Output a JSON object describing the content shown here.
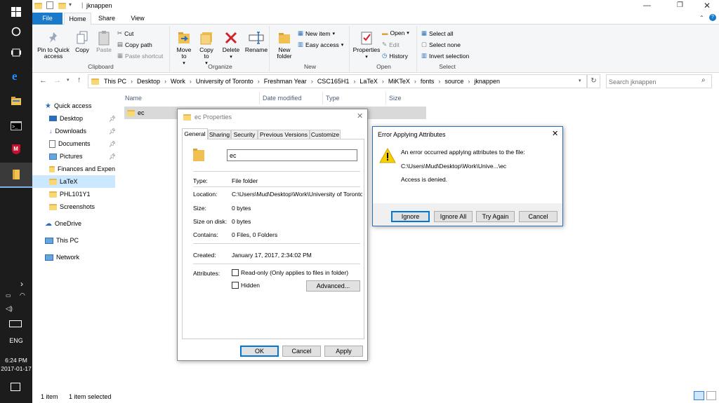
{
  "taskbar": {
    "time": "6:24 PM",
    "date": "2017-01-17",
    "language": "ENG",
    "icons": [
      "windows-start-icon",
      "cortana-icon",
      "task-view-icon",
      "edge-icon",
      "file-explorer-icon",
      "terminal-icon",
      "mcafee-icon",
      "folder-icon"
    ]
  },
  "explorer": {
    "title": "jknappen",
    "tabs": [
      "File",
      "Home",
      "Share",
      "View"
    ],
    "ribbon": {
      "clipboard": {
        "label": "Clipboard",
        "pin": "Pin to Quick access",
        "copy": "Copy",
        "paste": "Paste",
        "cut": "Cut",
        "copy_path": "Copy path",
        "paste_shortcut": "Paste shortcut"
      },
      "organize": {
        "label": "Organize",
        "move_to": "Move to",
        "copy_to": "Copy to",
        "delete": "Delete",
        "rename": "Rename"
      },
      "new": {
        "label": "New",
        "new_folder": "New folder",
        "new_item": "New item",
        "easy_access": "Easy access"
      },
      "open": {
        "label": "Open",
        "properties": "Properties",
        "open": "Open",
        "edit": "Edit",
        "history": "History"
      },
      "select": {
        "label": "Select",
        "select_all": "Select all",
        "select_none": "Select none",
        "invert": "Invert selection"
      }
    },
    "breadcrumb": [
      "This PC",
      "Desktop",
      "Work",
      "University of Toronto",
      "Freshman Year",
      "CSC165H1",
      "LaTeX",
      "MiKTeX",
      "fonts",
      "source",
      "jknappen"
    ],
    "search_placeholder": "Search jknappen",
    "nav": {
      "quick_access": "Quick access",
      "items": [
        "Desktop",
        "Downloads",
        "Documents",
        "Pictures",
        "Finances and Expen",
        "LaTeX",
        "PHL101Y1",
        "Screenshots"
      ],
      "onedrive": "OneDrive",
      "this_pc": "This PC",
      "network": "Network"
    },
    "columns": [
      "Name",
      "Date modified",
      "Type",
      "Size"
    ],
    "files": [
      {
        "name": "ec"
      }
    ],
    "status": {
      "count": "1 item",
      "selected": "1 item selected"
    }
  },
  "properties": {
    "title": "ec Properties",
    "tabs": [
      "General",
      "Sharing",
      "Security",
      "Previous Versions",
      "Customize"
    ],
    "name": "ec",
    "type_label": "Type:",
    "type": "File folder",
    "location_label": "Location:",
    "location": "C:\\Users\\Mud\\Desktop\\Work\\University of Toronto",
    "size_label": "Size:",
    "size": "0 bytes",
    "size_disk_label": "Size on disk:",
    "size_disk": "0 bytes",
    "contains_label": "Contains:",
    "contains": "0 Files, 0 Folders",
    "created_label": "Created:",
    "created": "January 17, 2017, 2:34:02 PM",
    "attributes_label": "Attributes:",
    "readonly": "Read-only (Only applies to files in folder)",
    "hidden": "Hidden",
    "advanced": "Advanced...",
    "ok": "OK",
    "cancel": "Cancel",
    "apply": "Apply"
  },
  "error": {
    "title": "Error Applying Attributes",
    "message": "An error occurred applying attributes to the file:",
    "path": "C:\\Users\\Mud\\Desktop\\Work\\Unive...\\ec",
    "detail": "Access is denied.",
    "ignore": "Ignore",
    "ignore_all": "Ignore All",
    "try_again": "Try Again",
    "cancel": "Cancel"
  }
}
